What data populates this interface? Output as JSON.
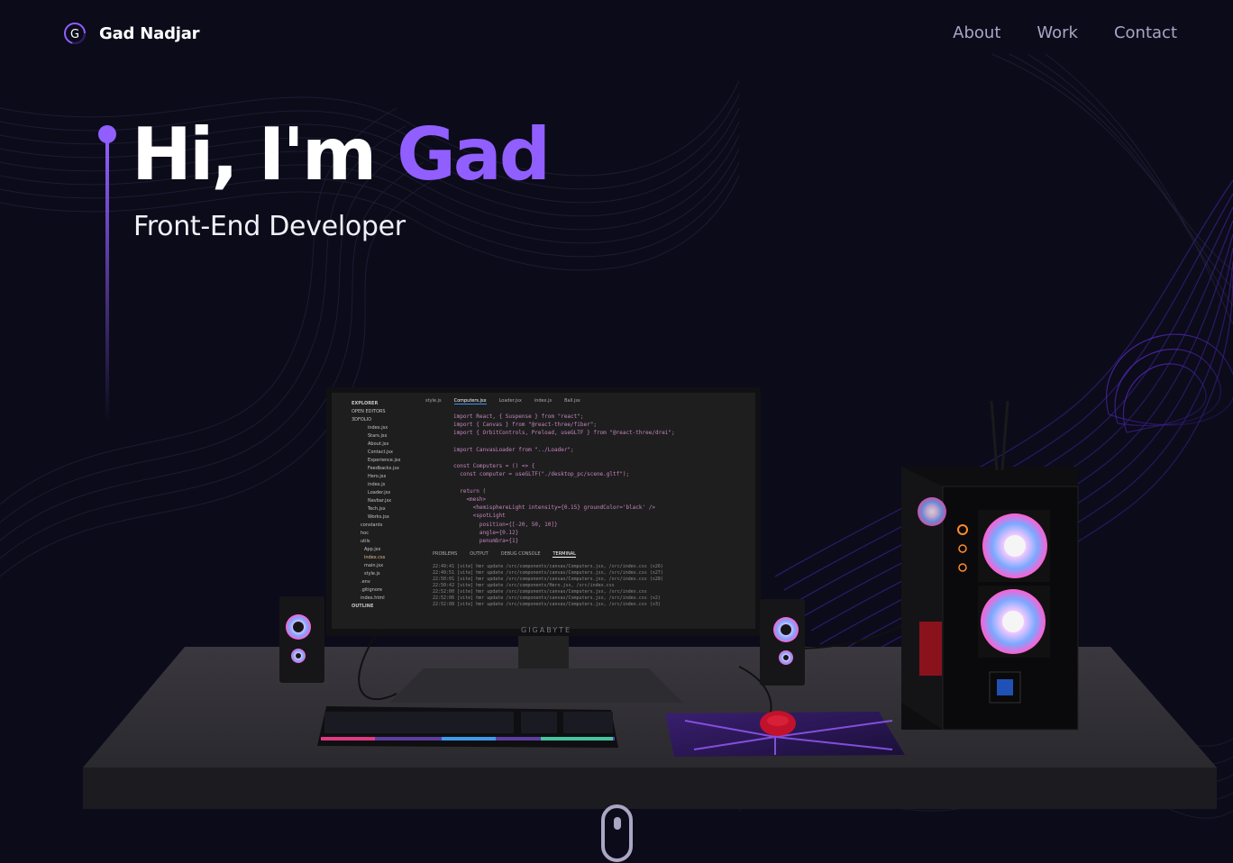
{
  "nav": {
    "logo_letter": "G",
    "brand_name": "Gad Nadjar",
    "links": [
      "About",
      "Work",
      "Contact"
    ]
  },
  "hero": {
    "greeting": "Hi, I'm ",
    "name": "Gad",
    "subtitle": "Front-End Developer"
  },
  "editor": {
    "tabs": [
      "style.js",
      "Computers.jsx",
      "Loader.jsx",
      "index.js",
      "Ball.jsx"
    ],
    "explorer_header": "EXPLORER",
    "explorer_items": [
      "OPEN EDITORS",
      "3DFOLIO",
      "index.jsx",
      "Stars.jsx",
      "About.jsx",
      "Contact.jsx",
      "Experience.jsx",
      "Feedbacks.jsx",
      "Hero.jsx",
      "index.js",
      "Loader.jsx",
      "Navbar.jsx",
      "Tech.jsx",
      "Works.jsx",
      "constants",
      "hoc",
      "utils",
      "App.jsx",
      "index.css",
      "main.jsx",
      "style.js",
      ".env",
      ".gitignore",
      "index.html",
      "OUTLINE"
    ],
    "code": "import React, { Suspense } from \"react\";\nimport { Canvas } from \"@react-three/fiber\";\nimport { OrbitControls, Preload, useGLTF } from \"@react-three/drei\";\n\nimport CanvasLoader from \"../Loader\";\n\nconst Computers = () => {\n  const computer = useGLTF(\"./desktop_pc/scene.gltf\");\n\n  return (\n    <mesh>\n      <hemisphereLight intensity={0.15} groundColor='black' />\n      <spotLight\n        position={[-20, 50, 10]}\n        angle={0.12}\n        penumbra={1}",
    "terminal_tabs": [
      "PROBLEMS",
      "OUTPUT",
      "DEBUG CONSOLE",
      "TERMINAL"
    ],
    "terminal": "22:49:41 [vite] hmr update /src/components/canvas/Computers.jsx, /src/index.css (x26)\n22:49:51 [vite] hmr update /src/components/canvas/Computers.jsx, /src/index.css (x27)\n22:50:01 [vite] hmr update /src/components/canvas/Computers.jsx, /src/index.css (x28)\n22:50:42 [vite] hmr update /src/components/Hero.jsx, /src/index.css\n22:52:00 [vite] hmr update /src/components/canvas/Computers.jsx, /src/index.css\n22:52:06 [vite] hmr update /src/components/canvas/Computers.jsx, /src/index.css (x2)\n22:52:08 [vite] hmr update /src/components/canvas/Computers.jsx, /src/index.css (x3)",
    "monitor_brand": "GIGABYTE"
  },
  "colors": {
    "accent": "#915eff",
    "background": "#0c0b1a",
    "nav_link": "#a9a5c4"
  }
}
